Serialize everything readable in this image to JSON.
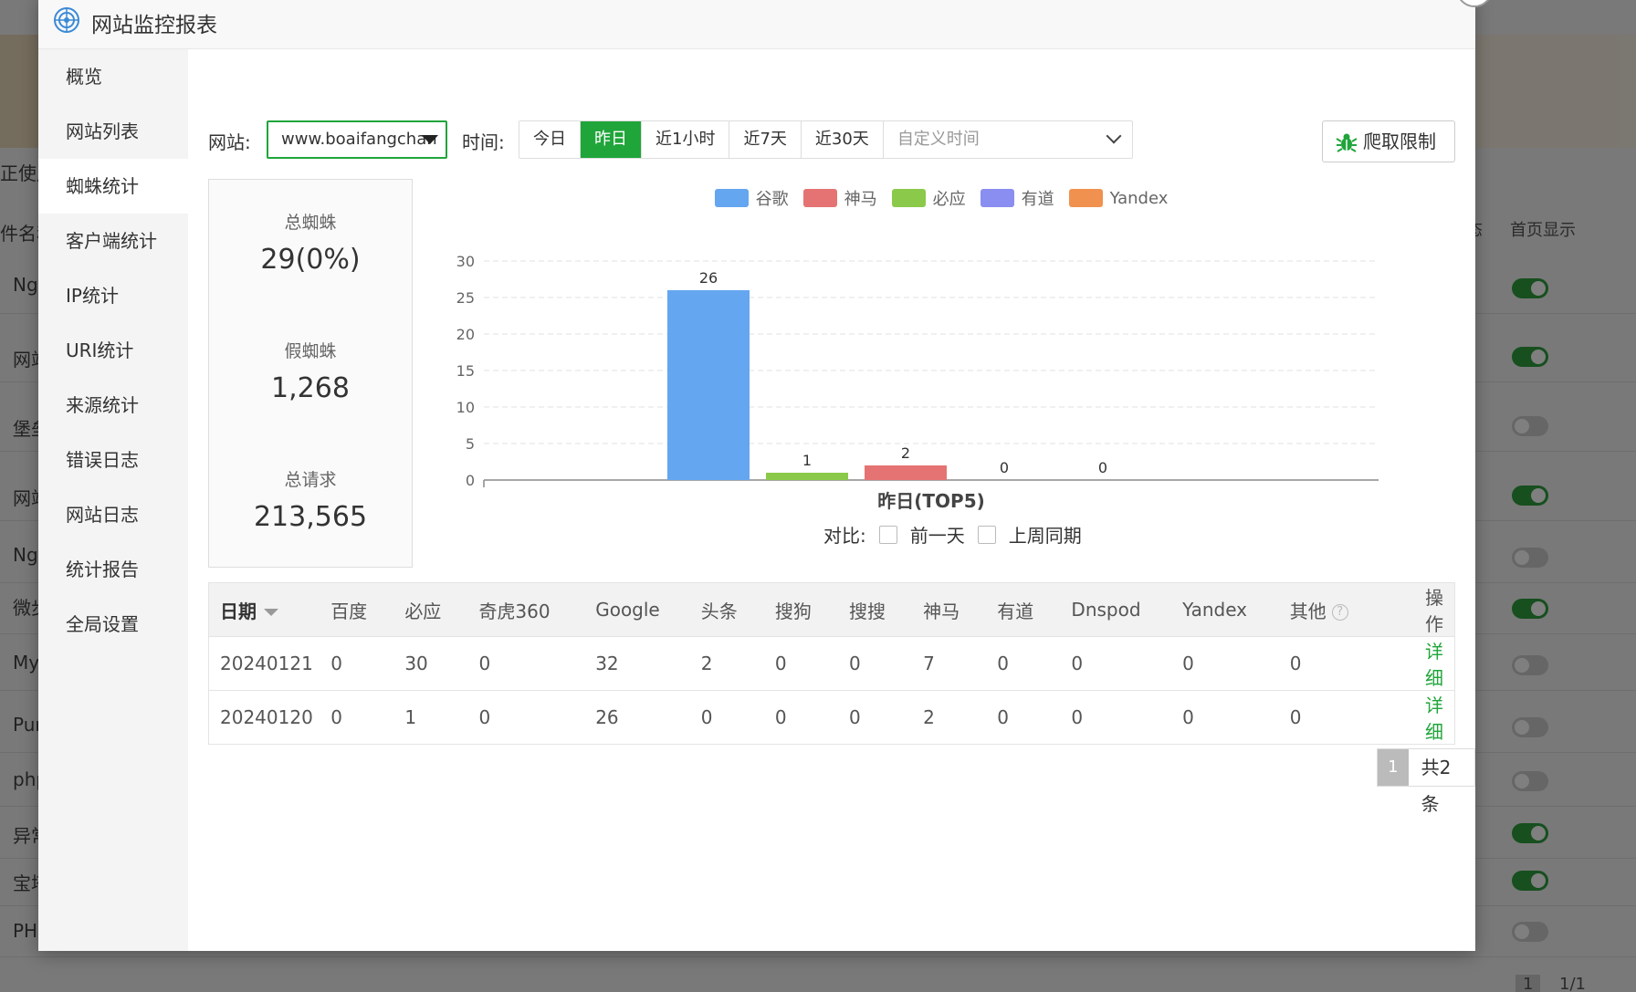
{
  "background": {
    "left_texts": [
      "正使用",
      "件名称",
      "Ngi",
      "网站",
      "堡垒",
      "网站",
      "Ngi",
      "微步",
      "MyS",
      "Pur",
      "php",
      "异常",
      "宝塔",
      "PHP"
    ],
    "right_header": [
      "态",
      "首页显示"
    ],
    "toggles": [
      true,
      true,
      false,
      true,
      false,
      true,
      false,
      false,
      false,
      true,
      true,
      false
    ],
    "pager": [
      "1",
      "1/1"
    ]
  },
  "modal": {
    "title": "网站监控报表",
    "close_icon": "×"
  },
  "sidebar": {
    "items": [
      {
        "label": "概览"
      },
      {
        "label": "网站列表"
      },
      {
        "label": "蜘蛛统计"
      },
      {
        "label": "客户端统计"
      },
      {
        "label": "IP统计"
      },
      {
        "label": "URI统计"
      },
      {
        "label": "来源统计"
      },
      {
        "label": "错误日志"
      },
      {
        "label": "网站日志"
      },
      {
        "label": "统计报告"
      },
      {
        "label": "全局设置"
      }
    ],
    "active_index": 2
  },
  "toolbar": {
    "site_label": "网站:",
    "site_value": "www.boaifangchan",
    "time_label": "时间:",
    "time_buttons": [
      "今日",
      "昨日",
      "近1小时",
      "近7天",
      "近30天"
    ],
    "time_active_index": 1,
    "custom_time_placeholder": "自定义时间",
    "crawl_limit_label": "爬取限制"
  },
  "stats": {
    "total_spiders_label": "总蜘蛛",
    "total_spiders_value": "29(0%)",
    "fake_spiders_label": "假蜘蛛",
    "fake_spiders_value": "1,268",
    "total_requests_label": "总请求",
    "total_requests_value": "213,565"
  },
  "chart_data": {
    "type": "bar",
    "title": "",
    "xlabel": "昨日(TOP5)",
    "ylabel": "",
    "ylim": [
      0,
      30
    ],
    "yticks": [
      0,
      5,
      10,
      15,
      20,
      25,
      30
    ],
    "grid": true,
    "legend_position": "top-center",
    "series": [
      {
        "name": "谷歌",
        "value": 26,
        "color": "#64a6f0"
      },
      {
        "name": "必应",
        "value": 1,
        "color": "#8bc94a"
      },
      {
        "name": "神马",
        "value": 2,
        "color": "#e57373"
      },
      {
        "name": "有道",
        "value": 0,
        "color": "#8a8ef0"
      },
      {
        "name": "Yandex",
        "value": 0,
        "color": "#f0914f"
      }
    ],
    "legend_order": [
      "谷歌",
      "神马",
      "必应",
      "有道",
      "Yandex"
    ]
  },
  "compare": {
    "label": "对比:",
    "options": [
      "前一天",
      "上周同期"
    ]
  },
  "table": {
    "headers": [
      "日期",
      "百度",
      "必应",
      "奇虎360",
      "Google",
      "头条",
      "搜狗",
      "搜搜",
      "神马",
      "有道",
      "Dnspod",
      "Yandex",
      "其他",
      "操作"
    ],
    "rows": [
      [
        "20240121",
        "0",
        "30",
        "0",
        "32",
        "2",
        "0",
        "0",
        "7",
        "0",
        "0",
        "0",
        "0",
        "详细"
      ],
      [
        "20240120",
        "0",
        "1",
        "0",
        "26",
        "0",
        "0",
        "0",
        "2",
        "0",
        "0",
        "0",
        "0",
        "详细"
      ]
    ],
    "help_icon": "?"
  },
  "pagination": {
    "current_page": "1",
    "total_text": "共2条"
  }
}
